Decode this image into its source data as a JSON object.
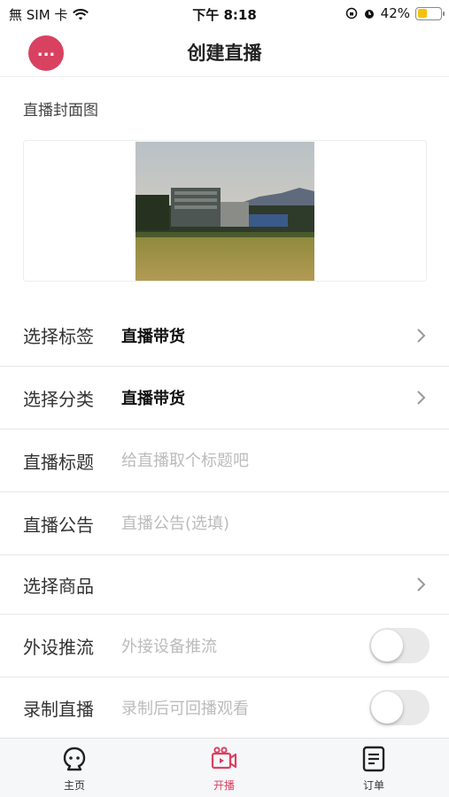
{
  "status_bar": {
    "carrier": "無 SIM 卡",
    "time": "下午 8:18",
    "battery_percent": "42%",
    "battery_level": 0.42
  },
  "nav": {
    "back_label": "...",
    "title": "创建直播"
  },
  "cover": {
    "label": "直播封面图"
  },
  "form": {
    "tag": {
      "label": "选择标签",
      "value": "直播带货"
    },
    "category": {
      "label": "选择分类",
      "value": "直播带货"
    },
    "title": {
      "label": "直播标题",
      "placeholder": "给直播取个标题吧"
    },
    "notice": {
      "label": "直播公告",
      "placeholder": "直播公告(选填)"
    },
    "product": {
      "label": "选择商品"
    },
    "external_push": {
      "label": "外设推流",
      "hint": "外接设备推流",
      "enabled": false
    },
    "record": {
      "label": "录制直播",
      "hint": "录制后可回播观看",
      "enabled": false
    }
  },
  "tabs": [
    {
      "label": "主页",
      "icon": "home-face-icon",
      "active": false
    },
    {
      "label": "开播",
      "icon": "video-camera-icon",
      "active": true
    },
    {
      "label": "订单",
      "icon": "order-document-icon",
      "active": false
    }
  ],
  "colors": {
    "accent": "#d94160",
    "toggle_off": "#e9e9ea",
    "battery": "#f4c20d"
  }
}
